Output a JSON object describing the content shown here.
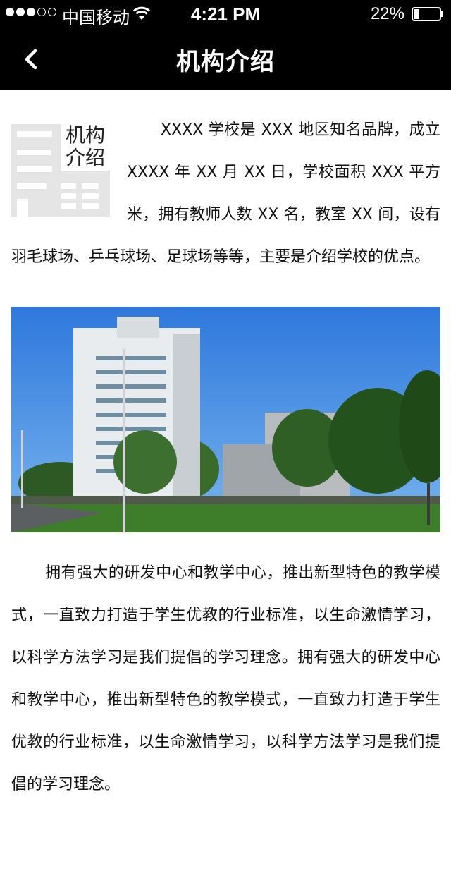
{
  "status_bar": {
    "carrier": "中国移动",
    "time": "4:21 PM",
    "battery_percent": "22%",
    "signal_bars_filled": 3,
    "signal_bars_total": 5,
    "battery_level": 0.22
  },
  "nav": {
    "title": "机构介绍",
    "back_icon": "chevron-left-icon"
  },
  "intro": {
    "logo_label": "机构\n介绍",
    "text": "XXXX 学校是 XXX 地区知名品牌，成立 XXXX 年 XX 月 XX 日，学校面积 XXX 平方米，拥有教师人数 XX 名，教室 XX 间，设有羽毛球场、乒乓球场、足球场等等，主要是介绍学校的优点。"
  },
  "body": {
    "text": "拥有强大的研发中心和教学中心，推出新型特色的教学模式，一直致力打造于学生优教的行业标准，以生命激情学习，以科学方法学习是我们提倡的学习理念。拥有强大的研发中心和教学中心，推出新型特色的教学模式，一直致力打造于学生优教的行业标准，以生命激情学习，以科学方法学习是我们提倡的学习理念。"
  },
  "colors": {
    "bar_background": "#000000",
    "sky": "#3a86e0",
    "grass": "#3e7d2a"
  }
}
